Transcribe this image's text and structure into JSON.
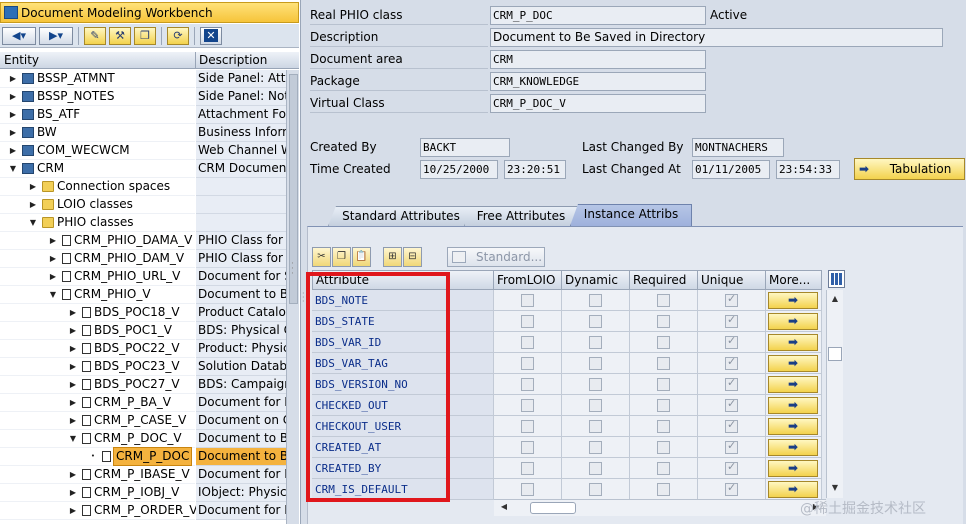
{
  "left": {
    "title": "Document Modeling Workbench",
    "columns": {
      "entity": "Entity",
      "description": "Description"
    },
    "tree": [
      {
        "label": "BSSP_ATMNT",
        "desc": "Side Panel: Attac",
        "level": 0,
        "icon": "book-icon",
        "expanded": false
      },
      {
        "label": "BSSP_NOTES",
        "desc": "Side Panel: Note",
        "level": 0,
        "icon": "book-icon",
        "expanded": false
      },
      {
        "label": "BS_ATF",
        "desc": "Attachment Fold",
        "level": 0,
        "icon": "book-icon",
        "expanded": false
      },
      {
        "label": "BW",
        "desc": "Business Inform",
        "level": 0,
        "icon": "book-icon",
        "expanded": false
      },
      {
        "label": "COM_WECWCM",
        "desc": "Web Channel W",
        "level": 0,
        "icon": "book-icon",
        "expanded": false
      },
      {
        "label": "CRM",
        "desc": "CRM Document",
        "level": 0,
        "icon": "book-icon",
        "expanded": true
      },
      {
        "label": "Connection spaces",
        "desc": "",
        "level": 1,
        "icon": "folder-icon",
        "expanded": false
      },
      {
        "label": "LOIO classes",
        "desc": "",
        "level": 1,
        "icon": "folder-icon",
        "expanded": false
      },
      {
        "label": "PHIO classes",
        "desc": "",
        "level": 1,
        "icon": "folder-icon",
        "expanded": true
      },
      {
        "label": "CRM_PHIO_DAMA_V",
        "desc": "PHIO Class for D",
        "level": 2,
        "icon": "doc-icon",
        "expanded": false
      },
      {
        "label": "CRM_PHIO_DAM_V",
        "desc": "PHIO Class for D",
        "level": 2,
        "icon": "doc-icon",
        "expanded": false
      },
      {
        "label": "CRM_PHIO_URL_V",
        "desc": "Document for S",
        "level": 2,
        "icon": "doc-icon",
        "expanded": false
      },
      {
        "label": "CRM_PHIO_V",
        "desc": "Document to Be",
        "level": 2,
        "icon": "doc-icon",
        "expanded": true
      },
      {
        "label": "BDS_POC18_V",
        "desc": "Product Catalog",
        "level": 3,
        "icon": "doc-icon",
        "expanded": false
      },
      {
        "label": "BDS_POC1_V",
        "desc": "BDS: Physical O",
        "level": 3,
        "icon": "doc-icon",
        "expanded": false
      },
      {
        "label": "BDS_POC22_V",
        "desc": "Product: Physic",
        "level": 3,
        "icon": "doc-icon",
        "expanded": false
      },
      {
        "label": "BDS_POC23_V",
        "desc": "Solution Databa",
        "level": 3,
        "icon": "doc-icon",
        "expanded": false
      },
      {
        "label": "BDS_POC27_V",
        "desc": "BDS: Campaigns",
        "level": 3,
        "icon": "doc-icon",
        "expanded": false
      },
      {
        "label": "CRM_P_BA_V",
        "desc": "Document for B",
        "level": 3,
        "icon": "doc-icon",
        "expanded": false
      },
      {
        "label": "CRM_P_CASE_V",
        "desc": "Document on C",
        "level": 3,
        "icon": "doc-icon",
        "expanded": false
      },
      {
        "label": "CRM_P_DOC_V",
        "desc": "Document to Be",
        "level": 3,
        "icon": "doc-icon",
        "expanded": true
      },
      {
        "label": "CRM_P_DOC",
        "desc": "Document to B",
        "level": 4,
        "icon": "doc-icon",
        "expanded": false,
        "leaf": true,
        "selected": true
      },
      {
        "label": "CRM_P_IBASE_V",
        "desc": "Document for B",
        "level": 3,
        "icon": "doc-icon",
        "expanded": false
      },
      {
        "label": "CRM_P_IOBJ_V",
        "desc": "IObject: Physica",
        "level": 3,
        "icon": "doc-icon",
        "expanded": false
      },
      {
        "label": "CRM_P_ORDER_V",
        "desc": "Document for B",
        "level": 3,
        "icon": "doc-icon",
        "expanded": false
      }
    ]
  },
  "details": {
    "real_phio_class": {
      "label": "Real PHIO class",
      "value": "CRM_P_DOC",
      "status": "Active"
    },
    "description": {
      "label": "Description",
      "value": "Document to Be Saved in Directory"
    },
    "document_area": {
      "label": "Document area",
      "value": "CRM"
    },
    "package": {
      "label": "Package",
      "value": "CRM_KNOWLEDGE"
    },
    "virtual_class": {
      "label": "Virtual Class",
      "value": "CRM_P_DOC_V"
    },
    "created_by": {
      "label": "Created By",
      "value": "BACKT"
    },
    "time_created": {
      "label": "Time Created",
      "date": "10/25/2000",
      "time": "23:20:51"
    },
    "last_changed_by": {
      "label": "Last Changed By",
      "value": "MONTNACHERS"
    },
    "last_changed_at": {
      "label": "Last Changed At",
      "date": "01/11/2005",
      "time": "23:54:33"
    },
    "tabulation_button": "Tabulation"
  },
  "tabs": [
    "Standard Attributes",
    "Free Attributes",
    "Instance Attribs"
  ],
  "active_tab": "Instance Attribs",
  "table_toolbar": {
    "standard_button": "Standard..."
  },
  "table": {
    "columns": [
      "Attribute",
      "FromLOIO",
      "Dynamic",
      "Required",
      "Unique",
      "More..."
    ],
    "rows": [
      {
        "attribute": "BDS_NOTE",
        "from_loio": false,
        "dynamic": false,
        "required": false,
        "unique": true
      },
      {
        "attribute": "BDS_STATE",
        "from_loio": false,
        "dynamic": false,
        "required": false,
        "unique": true
      },
      {
        "attribute": "BDS_VAR_ID",
        "from_loio": false,
        "dynamic": false,
        "required": false,
        "unique": true
      },
      {
        "attribute": "BDS_VAR_TAG",
        "from_loio": false,
        "dynamic": false,
        "required": false,
        "unique": true
      },
      {
        "attribute": "BDS_VERSION_NO",
        "from_loio": false,
        "dynamic": false,
        "required": false,
        "unique": true
      },
      {
        "attribute": "CHECKED_OUT",
        "from_loio": false,
        "dynamic": false,
        "required": false,
        "unique": true
      },
      {
        "attribute": "CHECKOUT_USER",
        "from_loio": false,
        "dynamic": false,
        "required": false,
        "unique": true
      },
      {
        "attribute": "CREATED_AT",
        "from_loio": false,
        "dynamic": false,
        "required": false,
        "unique": true
      },
      {
        "attribute": "CREATED_BY",
        "from_loio": false,
        "dynamic": false,
        "required": false,
        "unique": true
      },
      {
        "attribute": "CRM_IS_DEFAULT",
        "from_loio": false,
        "dynamic": false,
        "required": false,
        "unique": true
      }
    ]
  },
  "watermark": "@稀土掘金技术社区",
  "colors": {
    "highlight_border": "#e0171c",
    "selection": "#f4b23e",
    "title_bar": "#f6c43a"
  }
}
